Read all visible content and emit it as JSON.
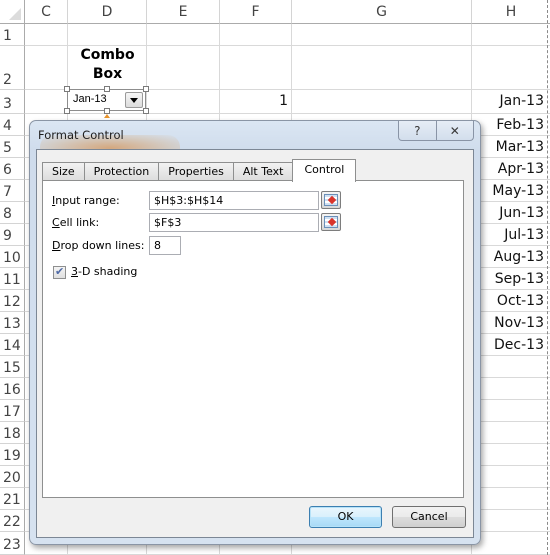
{
  "spreadsheet": {
    "columns": [
      "C",
      "D",
      "E",
      "F",
      "G",
      "H"
    ],
    "rows": [
      "1",
      "2",
      "3",
      "4",
      "5",
      "6",
      "7",
      "8",
      "9",
      "10",
      "11",
      "12",
      "13",
      "14",
      "15",
      "16",
      "17",
      "18",
      "19",
      "20",
      "21",
      "22",
      "23"
    ],
    "combo_label": "Combo Box",
    "combo_label_line1": "Combo",
    "combo_label_line2": "Box",
    "combo_selected": "Jan-13",
    "f3_value": "1",
    "h_values": [
      "Jan-13",
      "Feb-13",
      "Mar-13",
      "Apr-13",
      "May-13",
      "Jun-13",
      "Jul-13",
      "Aug-13",
      "Sep-13",
      "Oct-13",
      "Nov-13",
      "Dec-13"
    ]
  },
  "dialog": {
    "title": "Format Control",
    "help_icon": "?",
    "close_icon": "✕",
    "tabs": [
      {
        "label": "Size",
        "active": false
      },
      {
        "label": "Protection",
        "active": false
      },
      {
        "label": "Properties",
        "active": false
      },
      {
        "label": "Alt Text",
        "active": false
      },
      {
        "label": "Control",
        "active": true
      }
    ],
    "fields": {
      "input_range": {
        "label_accel": "I",
        "label_rest": "nput range:",
        "value": "$H$3:$H$14"
      },
      "cell_link": {
        "label_accel": "C",
        "label_rest": "ell link:",
        "value": "$F$3"
      },
      "drop_down_lines": {
        "label_accel": "D",
        "label_rest": "rop down lines:",
        "value": "8"
      },
      "shading": {
        "label_accel": "3",
        "label_rest": "-D shading",
        "checked": true
      }
    },
    "ok_label": "OK",
    "cancel_label": "Cancel"
  }
}
